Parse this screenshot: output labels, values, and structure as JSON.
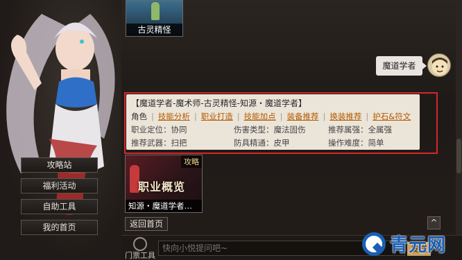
{
  "top_card": {
    "caption": "古灵精怪"
  },
  "user_message": {
    "text": "魔道学者"
  },
  "answer": {
    "title": "【魔道学者-魔术师-古灵精怪-知源・魔道学者】",
    "plain_item": "角色",
    "links": [
      "技能分析",
      "职业打造",
      "技能加点",
      "装备推荐",
      "换装推荐",
      "护石&符文"
    ],
    "stats": [
      "职业定位：协同",
      "伤害类型：魔法固伤",
      "推荐属强：全属强",
      "推荐武器：扫把",
      "防具精通：皮甲",
      "操作难度：简单"
    ]
  },
  "menu": [
    "攻略站",
    "福利活动",
    "自助工具",
    "我的首页"
  ],
  "article_card": {
    "tag": "攻略",
    "image_text": "职业概览",
    "caption": "知源・魔道学者…"
  },
  "back_button": "返回首页",
  "scroll_up": "^",
  "tools": {
    "label": "门票工具"
  },
  "input": {
    "placeholder": "快向小悦提问吧~"
  },
  "send": {
    "label": "发送"
  },
  "watermark": {
    "text": "青元网"
  },
  "icons": [
    "scroll-up-icon",
    "tool-icon",
    "avatar",
    "watermark-logo-icon"
  ]
}
